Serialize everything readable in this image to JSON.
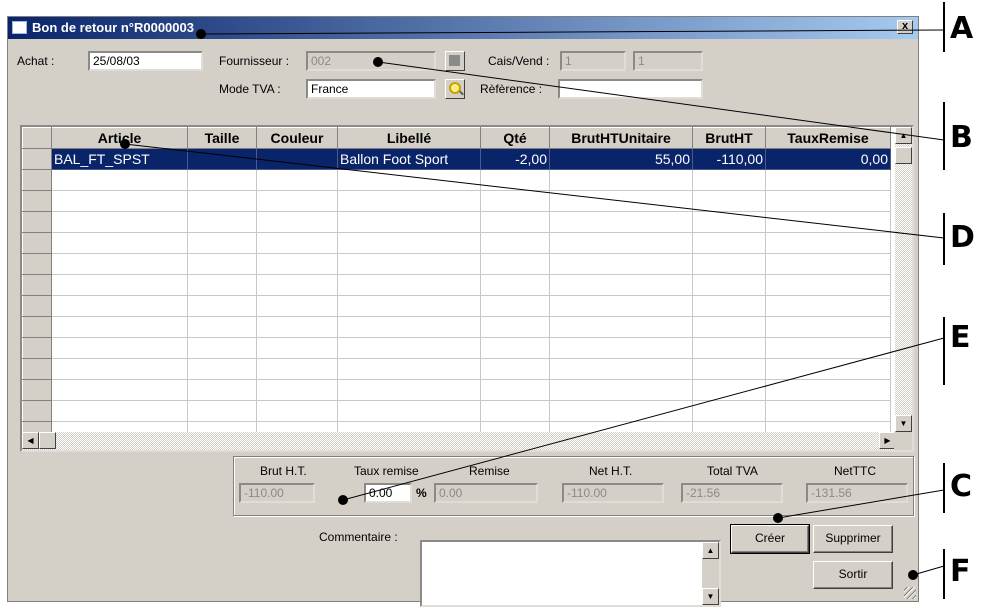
{
  "window": {
    "title": "Bon de retour n°R0000003",
    "close_label": "x"
  },
  "header": {
    "achat_label": "Achat :",
    "achat_value": "25/08/03",
    "fournisseur_label": "Fournisseur :",
    "fournisseur_value": "002",
    "mode_tva_label": "Mode TVA :",
    "mode_tva_value": "France",
    "cais_vend_label": "Cais/Vend :",
    "cais_value": "1",
    "vend_value": "1",
    "reference_label": "Rèfèrence :",
    "reference_value": ""
  },
  "grid": {
    "columns": [
      "Article",
      "Taille",
      "Couleur",
      "Libellé",
      "Qté",
      "BrutHTUnitaire",
      "BrutHT",
      "TauxRemise"
    ],
    "rows": [
      {
        "article": "BAL_FT_SPST",
        "taille": "",
        "couleur": "",
        "libelle": "Ballon Foot Sport",
        "qte": "-2,00",
        "brut_unit": "55,00",
        "brut_ht": "-110,00",
        "taux_remise": "0,00",
        "selected": true
      }
    ]
  },
  "totals": {
    "brut_ht_label": "Brut H.T.",
    "brut_ht_value": "-110.00",
    "taux_remise_label": "Taux remise",
    "taux_remise_value": "0.00",
    "percent_sign": "%",
    "remise_label": "Remise",
    "remise_value": "0.00",
    "net_ht_label": "Net H.T.",
    "net_ht_value": "-110.00",
    "total_tva_label": "Total TVA",
    "total_tva_value": "-21.56",
    "net_ttc_label": "NetTTC",
    "net_ttc_value": "-131.56"
  },
  "commentaire": {
    "label": "Commentaire :",
    "value": ""
  },
  "buttons": {
    "creer": "Créer",
    "supprimer": "Supprimer",
    "sortir": "Sortir"
  },
  "callouts": [
    "A",
    "B",
    "C",
    "D",
    "E",
    "F"
  ],
  "colors": {
    "title_start": "#0a246a",
    "title_end": "#a6caf0",
    "face": "#d4d0c8",
    "selection": "#0a246a"
  }
}
